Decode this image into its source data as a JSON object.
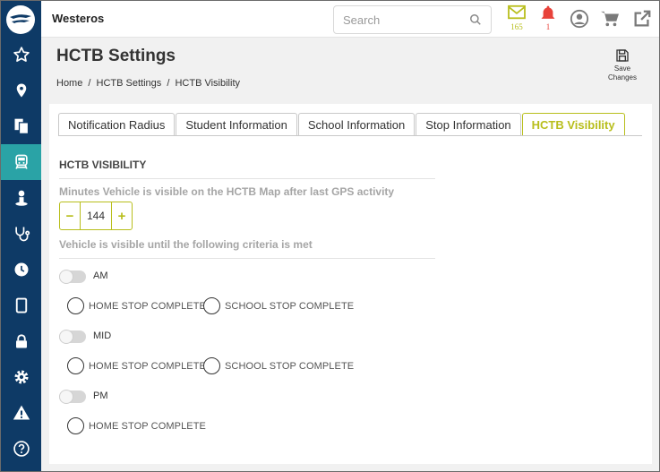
{
  "topbar": {
    "org_name": "Westeros",
    "search_placeholder": "Search",
    "messages_count": "165",
    "alerts_count": "1"
  },
  "sidebar": {
    "items": [
      {
        "icon": "star-icon"
      },
      {
        "icon": "map-pin-icon"
      },
      {
        "icon": "documents-icon"
      },
      {
        "icon": "bus-icon",
        "active": true
      },
      {
        "icon": "student-icon"
      },
      {
        "icon": "stethoscope-icon"
      },
      {
        "icon": "clock-icon"
      },
      {
        "icon": "tablet-icon"
      },
      {
        "icon": "lock-icon"
      },
      {
        "icon": "gear-icon"
      },
      {
        "icon": "warning-icon"
      },
      {
        "icon": "help-icon"
      }
    ]
  },
  "page": {
    "title": "HCTB Settings",
    "breadcrumb": [
      "Home",
      "/",
      "HCTB Settings",
      "/",
      "HCTB Visibility"
    ],
    "save_label_1": "Save",
    "save_label_2": "Changes"
  },
  "tabs": [
    {
      "label": "Notification Radius",
      "active": false
    },
    {
      "label": "Student Information",
      "active": false
    },
    {
      "label": "School Information",
      "active": false
    },
    {
      "label": "Stop Information",
      "active": false
    },
    {
      "label": "HCTB Visibility",
      "active": true
    }
  ],
  "visibility": {
    "section_title": "HCTB VISIBILITY",
    "minutes_label": "Minutes Vehicle is visible on the HCTB Map after last GPS activity",
    "minutes_value": "144",
    "minus": "−",
    "plus": "+",
    "criteria_label": "Vehicle is visible until the following criteria is met",
    "groups": [
      {
        "toggle_label": "AM",
        "enabled": false,
        "options": [
          "HOME STOP COMPLETE",
          "SCHOOL STOP COMPLETE"
        ]
      },
      {
        "toggle_label": "MID",
        "enabled": false,
        "options": [
          "HOME STOP COMPLETE",
          "SCHOOL STOP COMPLETE"
        ]
      },
      {
        "toggle_label": "PM",
        "enabled": false,
        "options": [
          "HOME STOP COMPLETE"
        ]
      }
    ]
  },
  "colors": {
    "sidebar_bg": "#0e3a66",
    "sidebar_active": "#2aa3a6",
    "accent": "#b8be1c",
    "alert": "#e8423a"
  }
}
